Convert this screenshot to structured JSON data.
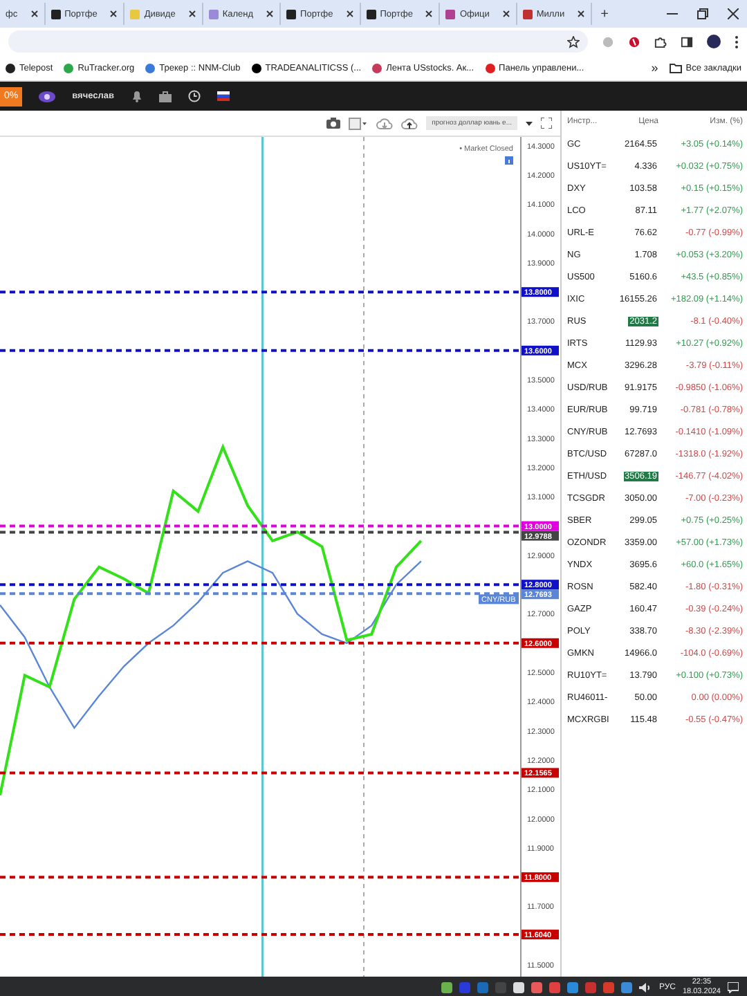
{
  "browser": {
    "tabs": [
      {
        "title": "фс",
        "selected": false
      },
      {
        "title": "Портфе",
        "selected": false
      },
      {
        "title": "Дивиде",
        "selected": false
      },
      {
        "title": "Календ",
        "selected": false
      },
      {
        "title": "Портфе",
        "selected": false
      },
      {
        "title": "Портфе",
        "selected": false
      },
      {
        "title": "Офици",
        "selected": false
      },
      {
        "title": "Милли",
        "selected": false
      }
    ],
    "new_tab": "+",
    "bookmarks": [
      "Telepost",
      "RuTracker.org",
      "Трекер :: NNM-Club",
      "TRADEANALITICSS (...",
      "Лента USstocks. Ак...",
      "Панель управлени..."
    ],
    "more_bookmarks": "»",
    "all_bookmarks": "Все закладки"
  },
  "app_bar": {
    "badge": "0%",
    "user": "вячеслав"
  },
  "chart_toolbar": {
    "template": "прогноз доллар юань е..."
  },
  "chart_status": "• Market Closed",
  "chart_data": {
    "type": "line",
    "categories": [
      null,
      null,
      null,
      null,
      null,
      null,
      null,
      null,
      null,
      null,
      null,
      null,
      null,
      null,
      null,
      null,
      null,
      null
    ],
    "ylim": [
      11.46,
      14.33
    ],
    "yticks": [
      {
        "value": 14.3,
        "label": "14.3000"
      },
      {
        "value": 14.2,
        "label": "14.2000"
      },
      {
        "value": 14.1,
        "label": "14.1000"
      },
      {
        "value": 14.0,
        "label": "14.0000"
      },
      {
        "value": 13.9,
        "label": "13.9000"
      },
      {
        "value": 13.7,
        "label": "13.7000"
      },
      {
        "value": 13.5,
        "label": "13.5000"
      },
      {
        "value": 13.4,
        "label": "13.4000"
      },
      {
        "value": 13.3,
        "label": "13.3000"
      },
      {
        "value": 13.2,
        "label": "13.2000"
      },
      {
        "value": 13.1,
        "label": "13.1000"
      },
      {
        "value": 12.9,
        "label": "12.9000"
      },
      {
        "value": 12.7,
        "label": "12.7000"
      },
      {
        "value": 12.5,
        "label": "12.5000"
      },
      {
        "value": 12.4,
        "label": "12.4000"
      },
      {
        "value": 12.3,
        "label": "12.3000"
      },
      {
        "value": 12.2,
        "label": "12.2000"
      },
      {
        "value": 12.1,
        "label": "12.1000"
      },
      {
        "value": 12.0,
        "label": "12.0000"
      },
      {
        "value": 11.9,
        "label": "11.9000"
      },
      {
        "value": 11.7,
        "label": "11.7000"
      },
      {
        "value": 11.5,
        "label": "11.5000"
      }
    ],
    "series": [
      {
        "name": "CNY/RUB",
        "color": "#5b86d8",
        "values": [
          12.73,
          12.62,
          12.45,
          12.31,
          12.42,
          12.52,
          12.6,
          12.66,
          12.74,
          12.84,
          12.88,
          12.84,
          12.7,
          12.63,
          12.6,
          12.66,
          12.8,
          12.88
        ]
      },
      {
        "color": "#33e01a",
        "values": [
          12.08,
          12.49,
          12.45,
          12.75,
          12.86,
          12.82,
          12.77,
          13.12,
          13.05,
          13.27,
          13.07,
          12.95,
          12.98,
          12.93,
          12.61,
          12.63,
          12.86,
          12.95
        ]
      }
    ],
    "ref_lines": [
      {
        "axis": "y",
        "value": 13.8,
        "label": "13.8000",
        "color": "#1010c8"
      },
      {
        "axis": "y",
        "value": 13.6,
        "label": "13.6000",
        "color": "#1010c8"
      },
      {
        "axis": "y",
        "value": 13.0,
        "label": "13.0000",
        "color": "#e000e0"
      },
      {
        "axis": "y",
        "value": 12.9788,
        "label": "12.9788",
        "color": "#444444"
      },
      {
        "axis": "y",
        "value": 12.8,
        "label": "12.8000",
        "color": "#1010c8"
      },
      {
        "axis": "y",
        "value": 12.7693,
        "label": "12.7693",
        "color": "#5b86d8"
      },
      {
        "axis": "y",
        "value": 12.6,
        "label": "12.6000",
        "color": "#c80000"
      },
      {
        "axis": "y",
        "value": 12.1565,
        "label": "12.1565",
        "color": "#c80000"
      },
      {
        "axis": "y",
        "value": 11.8,
        "label": "11.8000",
        "color": "#c80000"
      },
      {
        "axis": "y",
        "value": 11.604,
        "label": "11.6040",
        "color": "#c80000"
      }
    ]
  },
  "watchlist": {
    "columns": [
      "Инстр...",
      "Цена",
      "Изм. (%)"
    ],
    "rows": [
      {
        "symbol": "GC",
        "price": "2164.55",
        "change": "+3.05 (+0.14%)",
        "color": "#2e9e4f",
        "highlighted": false
      },
      {
        "symbol": "US10YT=",
        "price": "4.336",
        "change": "+0.032 (+0.75%)",
        "color": "#2e9e4f",
        "highlighted": false
      },
      {
        "symbol": "DXY",
        "price": "103.58",
        "change": "+0.15 (+0.15%)",
        "color": "#2e9e4f",
        "highlighted": false
      },
      {
        "symbol": "LCO",
        "price": "87.11",
        "change": "+1.77 (+2.07%)",
        "color": "#2e9e4f",
        "highlighted": false
      },
      {
        "symbol": "URL-E",
        "price": "76.62",
        "change": "-0.77 (-0.99%)",
        "color": "#d34848",
        "highlighted": false
      },
      {
        "symbol": "NG",
        "price": "1.708",
        "change": "+0.053 (+3.20%)",
        "color": "#2e9e4f",
        "highlighted": false
      },
      {
        "symbol": "US500",
        "price": "5160.6",
        "change": "+43.5 (+0.85%)",
        "color": "#2e9e4f",
        "highlighted": false
      },
      {
        "symbol": "IXIC",
        "price": "16155.26",
        "change": "+182.09 (+1.14%)",
        "color": "#2e9e4f",
        "highlighted": false
      },
      {
        "symbol": "RUS",
        "price": "2031.2",
        "change": "-8.1 (-0.40%)",
        "color": "#d34848",
        "highlighted": true
      },
      {
        "symbol": "IRTS",
        "price": "1129.93",
        "change": "+10.27 (+0.92%)",
        "color": "#2e9e4f",
        "highlighted": false
      },
      {
        "symbol": "MCX",
        "price": "3296.28",
        "change": "-3.79 (-0.11%)",
        "color": "#d34848",
        "highlighted": false
      },
      {
        "symbol": "USD/RUB",
        "price": "91.9175",
        "change": "-0.9850 (-1.06%)",
        "color": "#d34848",
        "highlighted": false
      },
      {
        "symbol": "EUR/RUB",
        "price": "99.719",
        "change": "-0.781 (-0.78%)",
        "color": "#d34848",
        "highlighted": false
      },
      {
        "symbol": "CNY/RUB",
        "price": "12.7693",
        "change": "-0.1410 (-1.09%)",
        "color": "#d34848",
        "highlighted": false
      },
      {
        "symbol": "BTC/USD",
        "price": "67287.0",
        "change": "-1318.0 (-1.92%)",
        "color": "#d34848",
        "highlighted": false
      },
      {
        "symbol": "ETH/USD",
        "price": "3506.19",
        "change": "-146.77 (-4.02%)",
        "color": "#d34848",
        "highlighted": true
      },
      {
        "symbol": "TCSGDR",
        "price": "3050.00",
        "change": "-7.00 (-0.23%)",
        "color": "#d34848",
        "highlighted": false
      },
      {
        "symbol": "SBER",
        "price": "299.05",
        "change": "+0.75 (+0.25%)",
        "color": "#2e9e4f",
        "highlighted": false
      },
      {
        "symbol": "OZONDR",
        "price": "3359.00",
        "change": "+57.00 (+1.73%)",
        "color": "#2e9e4f",
        "highlighted": false
      },
      {
        "symbol": "YNDX",
        "price": "3695.6",
        "change": "+60.0 (+1.65%)",
        "color": "#2e9e4f",
        "highlighted": false
      },
      {
        "symbol": "ROSN",
        "price": "582.40",
        "change": "-1.80 (-0.31%)",
        "color": "#d34848",
        "highlighted": false
      },
      {
        "symbol": "GAZP",
        "price": "160.47",
        "change": "-0.39 (-0.24%)",
        "color": "#d34848",
        "highlighted": false
      },
      {
        "symbol": "POLY",
        "price": "338.70",
        "change": "-8.30 (-2.39%)",
        "color": "#d34848",
        "highlighted": false
      },
      {
        "symbol": "GMKN",
        "price": "14966.0",
        "change": "-104.0 (-0.69%)",
        "color": "#d34848",
        "highlighted": false
      },
      {
        "symbol": "RU10YT=",
        "price": "13.790",
        "change": "+0.100 (+0.73%)",
        "color": "#2e9e4f",
        "highlighted": false
      },
      {
        "symbol": "RU46011-",
        "price": "50.00",
        "change": "0.00 (0.00%)",
        "color": "#d34848",
        "highlighted": false
      },
      {
        "symbol": "MCXRGBI",
        "price": "115.48",
        "change": "-0.55 (-0.47%)",
        "color": "#d34848",
        "highlighted": false
      }
    ]
  },
  "taskbar": {
    "language": "РУС",
    "time": "22:35",
    "date": "18.03.2024"
  }
}
